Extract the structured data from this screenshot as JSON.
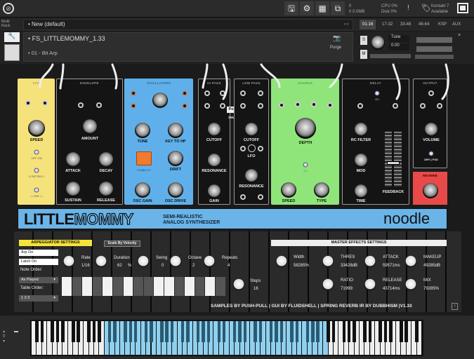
{
  "topbar": {
    "save_icon": "save-icon",
    "gear_icon": "gear-icon",
    "layout_icon": "layout-icon",
    "window_icon": "window-icon",
    "midi_voices": "0",
    "midi_mem": "0 0.0MB",
    "cpu": "CPU 0%",
    "disk": "Disk 0%",
    "warn": "!",
    "kontakt": "Kontakt 7",
    "available": "Available"
  },
  "rack": {
    "label1": "Multi",
    "label2": "Rack",
    "preset": "New (default)",
    "tabs": [
      "01-16",
      "17-32",
      "33-48",
      "49-64",
      "KSP",
      "AUX"
    ]
  },
  "instrument": {
    "name": "FS_LITTLEMOMMY_1.33",
    "preset": "01 - Bit Arp",
    "purge": "Purge",
    "tune_label": "Tune",
    "tune_value": "0.00",
    "s": "S",
    "m": "M"
  },
  "modules": {
    "lfo": {
      "title": "LFO",
      "speed": "SPEED",
      "off_on": "OFF  ON",
      "retrig": "O RETRIG I",
      "dir": "• • DIR • •"
    },
    "envelope": {
      "title": "ENVELOPE",
      "amount": "AMOUNT",
      "attack": "ATTACK",
      "decay": "DECAY",
      "sustain": "SUSTAIN",
      "release": "RELEASE"
    },
    "osc": {
      "title": "OSCILLATORS",
      "tune": "TUNE",
      "key": "KEY TO HP",
      "stability": "STABILITY",
      "drift": "DRIFT",
      "gain": "OSC GAIN",
      "drive": "OSC DRIVE"
    },
    "hipass": {
      "title": "HI PASS",
      "cutoff": "CUTOFF",
      "resonance": "RESONANCE",
      "gain": "GAIN",
      "post": "Post",
      "swap": "SWAP"
    },
    "lowpass": {
      "title": "LOW PASS",
      "cutoff": "CUTOFF",
      "lfo": "LFO",
      "resonance": "RESONANCE"
    },
    "chorus": {
      "title": "CHORUS",
      "depth": "DEPTH",
      "onoff": "O  I",
      "speed": "SPEED",
      "type": "TYPE"
    },
    "delay": {
      "title": "DELAY",
      "onoff": "O  I",
      "rcfilter": "RC FILTER",
      "mod": "MOD",
      "time": "TIME",
      "feedback": "FEEDBACK"
    },
    "output": {
      "title": "OUTPUT",
      "volume": "VOLUME",
      "dry": "DRY | FXD"
    },
    "reverb": {
      "title": "REVERB"
    }
  },
  "banner": {
    "title_bold": "LITTLE",
    "title_outline": "MOMMY",
    "sub1": "SEMI-REALISTIC",
    "sub2": "ANALOG SYNTHESIZER",
    "brand": "noodle"
  },
  "arp": {
    "header": "ARPEGGIATOR SETTINGS",
    "scale_velocity": "Scale By Velocity",
    "arp_on": "Arp On",
    "latch_on": "Latch On",
    "note_order_label": "Note Order:",
    "note_order": "As Played",
    "table_order_label": "Table Order:",
    "table_order": "1 2 3",
    "rate_label": "Rate",
    "rate": "1/16",
    "duration_label": "Duration",
    "duration": "62",
    "pct": "%",
    "swing_label": "Swing",
    "swing": "0",
    "octave_label": "Octave",
    "octave": "2",
    "repeats_label": "Repeats",
    "repeats": "4",
    "steps_label": "Steps",
    "steps": "16",
    "step_pattern": [
      1,
      0,
      1,
      0,
      1,
      0,
      1,
      0,
      0,
      1,
      1,
      0,
      1,
      0,
      1,
      0
    ]
  },
  "fx": {
    "header": "MASTER EFFECTS SETTINGS",
    "width_label": "Width",
    "width": "58285%",
    "thres_label": "THRES",
    "thres": "33428dB",
    "ratio_label": "RATIO",
    "ratio": "71999:",
    "attack_label": "ATTACK",
    "attack": "59571ms",
    "release_label": "RELEASE",
    "release": "43714ms",
    "makeup_label": "MAKEUP",
    "makeup": "49285dB",
    "mix_label": "MIX",
    "mix": "79285%"
  },
  "credits": "SAMPLES BY PUSH-PULL  | GUI BY FLUIDSHELL | SPRING REVERB IR BY DUBBHISM  |V1.33",
  "keyboard": {
    "octave": "0",
    "highlight_color": "#8fd0ee"
  }
}
